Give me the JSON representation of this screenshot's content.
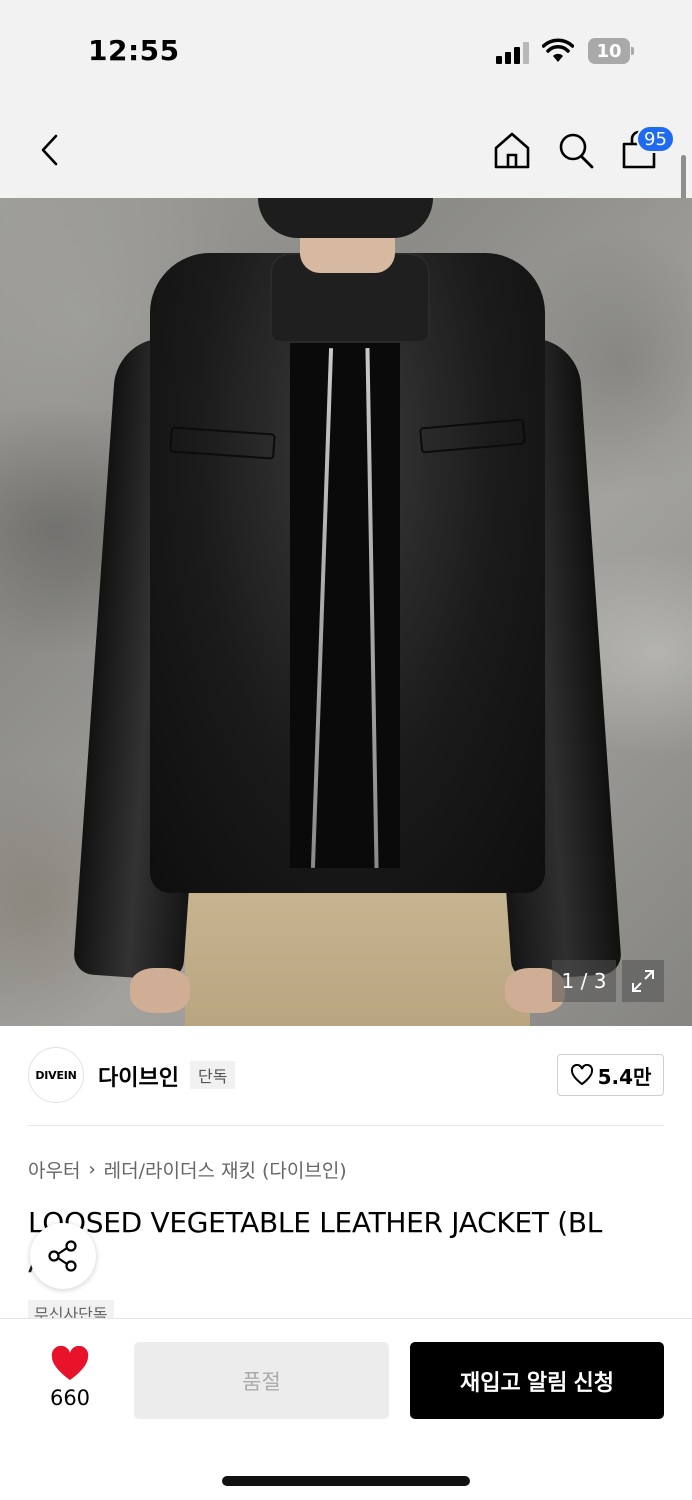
{
  "status_bar": {
    "time": "12:55",
    "battery": "10"
  },
  "nav": {
    "cart_count": "95"
  },
  "gallery": {
    "counter": "1 / 3"
  },
  "brand": {
    "logo_text": "DIVEIN",
    "name": "다이브인",
    "tag": "단독",
    "likes": "5.4만"
  },
  "product": {
    "breadcrumb": [
      "아우터",
      "레더/라이더스 재킷 (다이브인)"
    ],
    "title_line1": "LOOSED VEGETABLE LEATHER JACKET (BL",
    "title_line2": "A...)",
    "tag": "무신사단독"
  },
  "bottom_bar": {
    "fav_count": "660",
    "soldout_label": "품절",
    "restock_label": "재입고 알림 신청"
  },
  "colors": {
    "accent_badge": "#1e6bf2",
    "heart": "#e8132b",
    "primary_button": "#000000"
  }
}
